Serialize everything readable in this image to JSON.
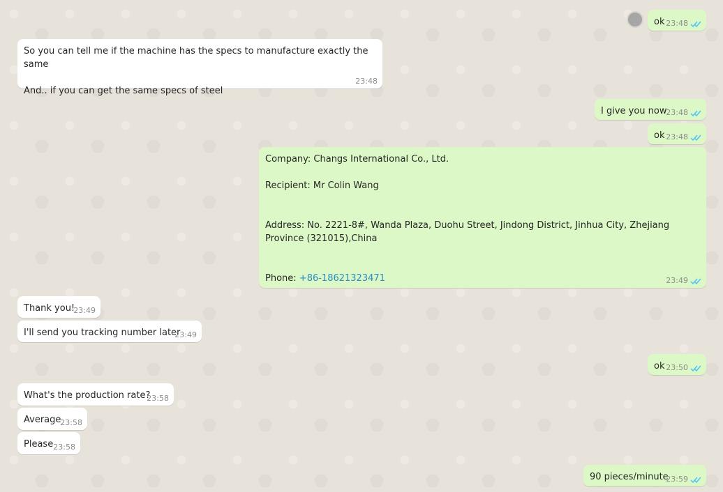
{
  "colors": {
    "outgoing_bubble": "#dcf8c6",
    "incoming_bubble": "#ffffff",
    "read_tick": "#4fc3f7",
    "link": "#2b8bc3"
  },
  "messages": [
    {
      "direction": "out",
      "text": "ok",
      "time": "23:48",
      "status": "read"
    },
    {
      "direction": "in",
      "text": "So you can tell me if the machine has the specs to manufacture exactly the same\n\nAnd.. if you can get the same specs of steel",
      "time": "23:48"
    },
    {
      "direction": "out",
      "text": "I give you now",
      "time": "23:48",
      "status": "read"
    },
    {
      "direction": "out",
      "text": "ok",
      "time": "23:48",
      "status": "read"
    },
    {
      "direction": "out",
      "company": "Company: Changs  International Co., Ltd.",
      "recipient": "Recipient: Mr Colin Wang",
      "address": "Address: No. 2221-8#, Wanda Plaza, Duohu Street, Jindong District, Jinhua City, Zhejiang Province (321015),China",
      "phone_label": "Phone: ",
      "phone": "+86-18621323471",
      "time": "23:49",
      "status": "read"
    },
    {
      "direction": "in",
      "text": "Thank you!",
      "time": "23:49"
    },
    {
      "direction": "in",
      "text": "I'll send you tracking number later",
      "time": "23:49"
    },
    {
      "direction": "out",
      "text": "ok",
      "time": "23:50",
      "status": "read"
    },
    {
      "direction": "in",
      "text": "What's the production rate?",
      "time": "23:58"
    },
    {
      "direction": "in",
      "text": "Average",
      "time": "23:58"
    },
    {
      "direction": "in",
      "text": "Please",
      "time": "23:58"
    },
    {
      "direction": "out",
      "text": "90 pieces/minute",
      "time": "23:59",
      "status": "read"
    }
  ]
}
